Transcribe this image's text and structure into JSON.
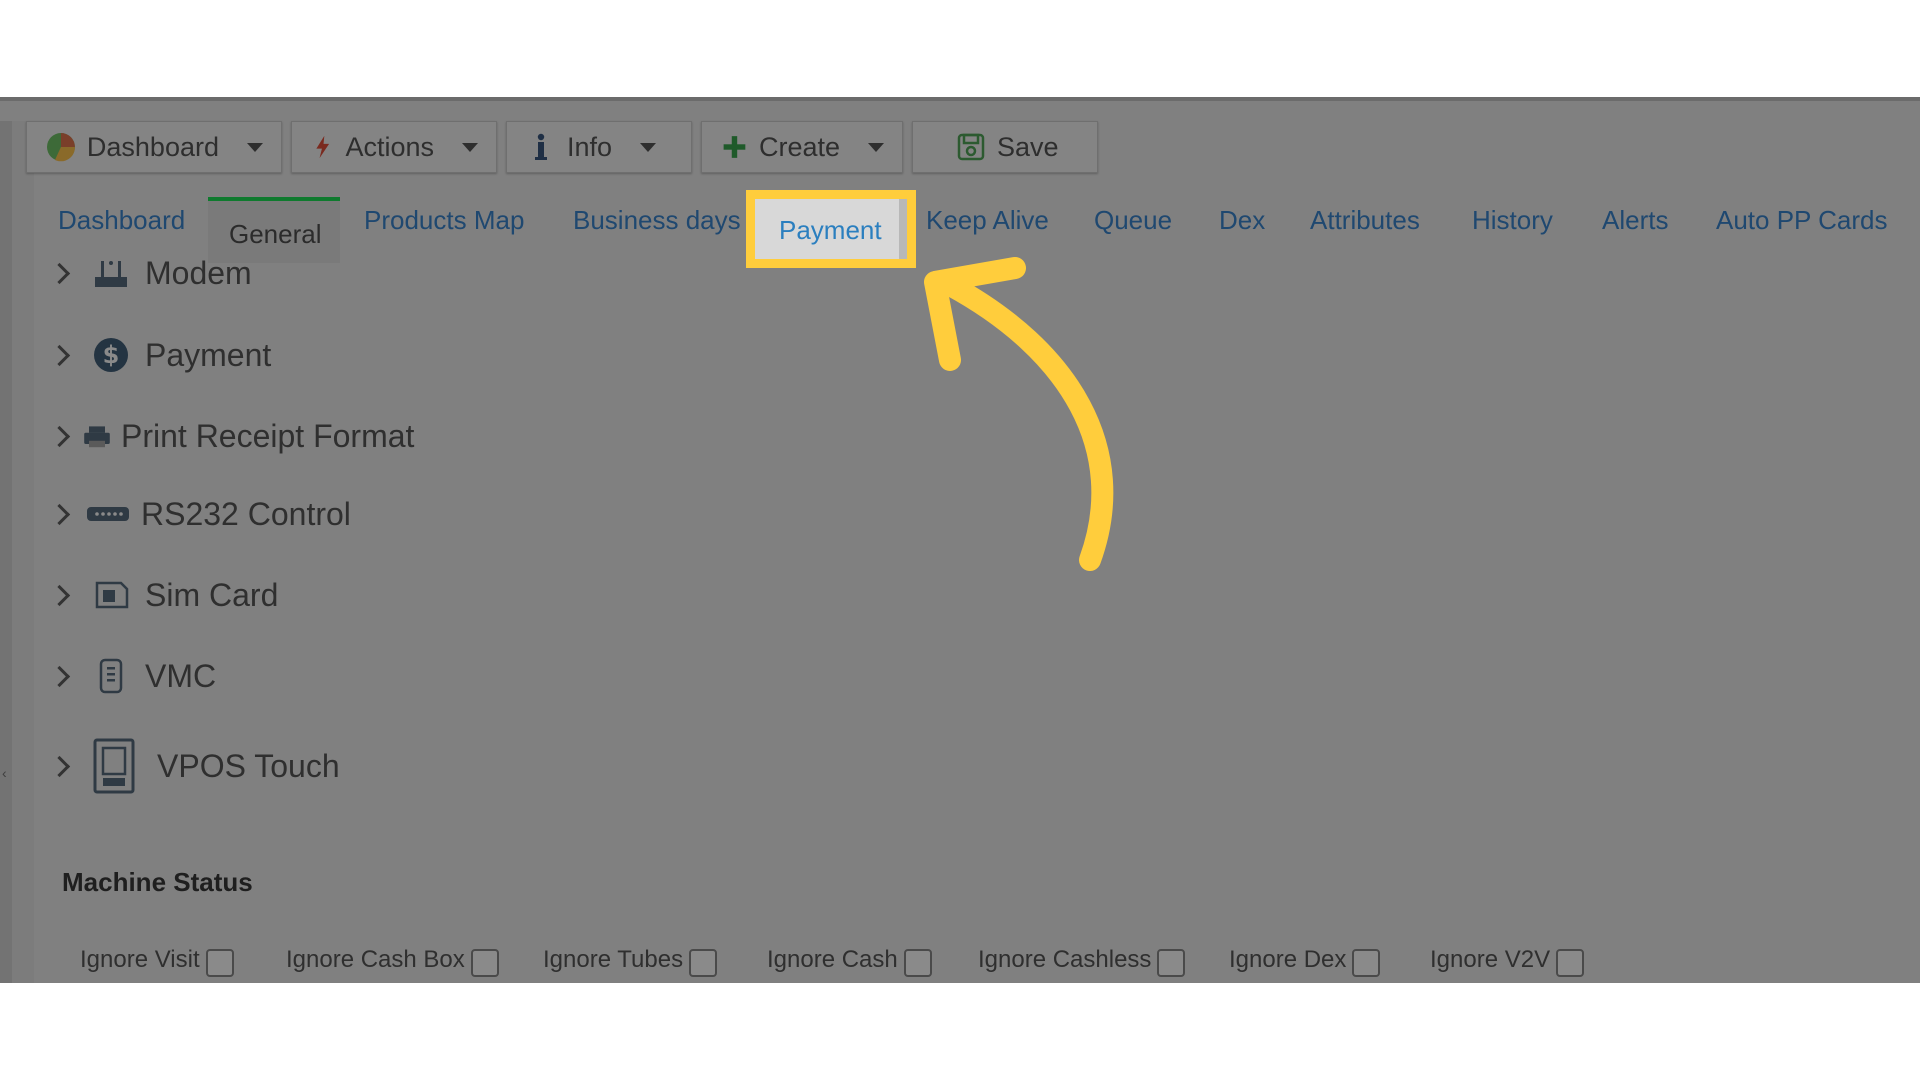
{
  "toolbar": {
    "dashboard_label": "Dashboard",
    "actions_label": "Actions",
    "info_label": "Info",
    "create_label": "Create",
    "save_label": "Save"
  },
  "tabs": {
    "dashboard": "Dashboard",
    "general": "General",
    "products_map": "Products Map",
    "business_days": "Business days",
    "payment": "Payment",
    "keep_alive": "Keep Alive",
    "queue": "Queue",
    "dex": "Dex",
    "attributes": "Attributes",
    "history": "History",
    "alerts": "Alerts",
    "auto_pp_cards": "Auto PP Cards"
  },
  "tree": {
    "items": [
      {
        "label": "Modem",
        "icon": "modem-icon"
      },
      {
        "label": "Payment",
        "icon": "dollar-icon"
      },
      {
        "label": "Print Receipt Format",
        "icon": "printer-icon"
      },
      {
        "label": "RS232 Control",
        "icon": "serial-port-icon"
      },
      {
        "label": "Sim Card",
        "icon": "sim-card-icon"
      },
      {
        "label": "VMC",
        "icon": "vmc-icon"
      },
      {
        "label": "VPOS Touch",
        "icon": "vpos-touch-icon"
      }
    ]
  },
  "machine_status": {
    "title": "Machine Status",
    "checkboxes": [
      {
        "label": "Ignore Visit",
        "checked": false
      },
      {
        "label": "Ignore Cash Box",
        "checked": false
      },
      {
        "label": "Ignore Tubes",
        "checked": false
      },
      {
        "label": "Ignore Cash",
        "checked": false
      },
      {
        "label": "Ignore Cashless",
        "checked": false
      },
      {
        "label": "Ignore Dex",
        "checked": false
      },
      {
        "label": "Ignore V2V",
        "checked": false
      }
    ]
  },
  "colors": {
    "highlight": "#ffcd3c",
    "overlay": "#808080",
    "tab_link": "#1f4870",
    "active_tab_border": "#0f7a2e"
  }
}
